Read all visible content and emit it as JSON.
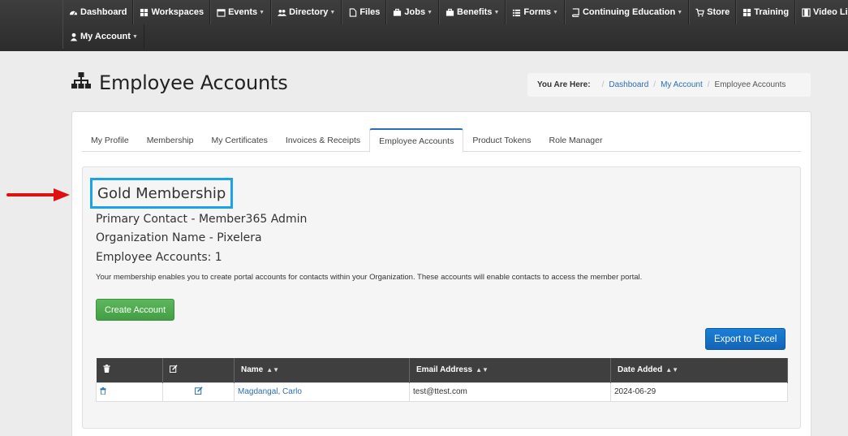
{
  "nav": {
    "row1": [
      {
        "label": "Dashboard",
        "icon": "dashboard-icon",
        "caret": false
      },
      {
        "label": "Workspaces",
        "icon": "grid-icon",
        "caret": false
      },
      {
        "label": "Events",
        "icon": "calendar-icon",
        "caret": true
      },
      {
        "label": "Directory",
        "icon": "users-icon",
        "caret": true
      },
      {
        "label": "Files",
        "icon": "file-icon",
        "caret": false
      },
      {
        "label": "Jobs",
        "icon": "briefcase-icon",
        "caret": true
      },
      {
        "label": "Benefits",
        "icon": "briefcase-icon",
        "caret": true
      },
      {
        "label": "Forms",
        "icon": "list-icon",
        "caret": true
      },
      {
        "label": "Continuing Education",
        "icon": "book-icon",
        "caret": true
      },
      {
        "label": "Store",
        "icon": "cart-icon",
        "caret": false
      },
      {
        "label": "Training",
        "icon": "grid-icon",
        "caret": false
      },
      {
        "label": "Video Library",
        "icon": "film-icon",
        "caret": false
      }
    ],
    "row2": [
      {
        "label": "My Account",
        "icon": "user-icon",
        "caret": true
      }
    ]
  },
  "page": {
    "title": "Employee Accounts",
    "title_icon": "sitemap-icon"
  },
  "breadcrumb": {
    "label": "You Are Here:",
    "items": [
      "Dashboard",
      "My Account",
      "Employee Accounts"
    ]
  },
  "tabs": [
    "My Profile",
    "Membership",
    "My Certificates",
    "Invoices & Receipts",
    "Employee Accounts",
    "Product Tokens",
    "Role Manager"
  ],
  "active_tab": "Employee Accounts",
  "membership": {
    "title": "Gold Membership",
    "primary_contact": "Primary Contact - Member365 Admin",
    "organization": "Organization Name - Pixelera",
    "employee_accounts": "Employee Accounts: 1",
    "note": "Your membership enables you to create portal accounts for contacts within your Organization. These accounts will enable contacts to access the member portal."
  },
  "buttons": {
    "create": "Create Account",
    "export": "Export to Excel"
  },
  "table": {
    "columns": [
      "",
      "",
      "Name",
      "Email Address",
      "Date Added"
    ],
    "rows": [
      {
        "name": "Magdangal, Carlo",
        "email": "test@ttest.com",
        "date": "2024-06-29"
      }
    ]
  },
  "colors": {
    "nav_bg": "#333333",
    "accent_blue": "#2a6fb5",
    "highlight_box": "#1aa3ea",
    "annotation_arrow": "#e01010",
    "create_button": "#5cb85c",
    "export_button": "#1a7fd6"
  }
}
